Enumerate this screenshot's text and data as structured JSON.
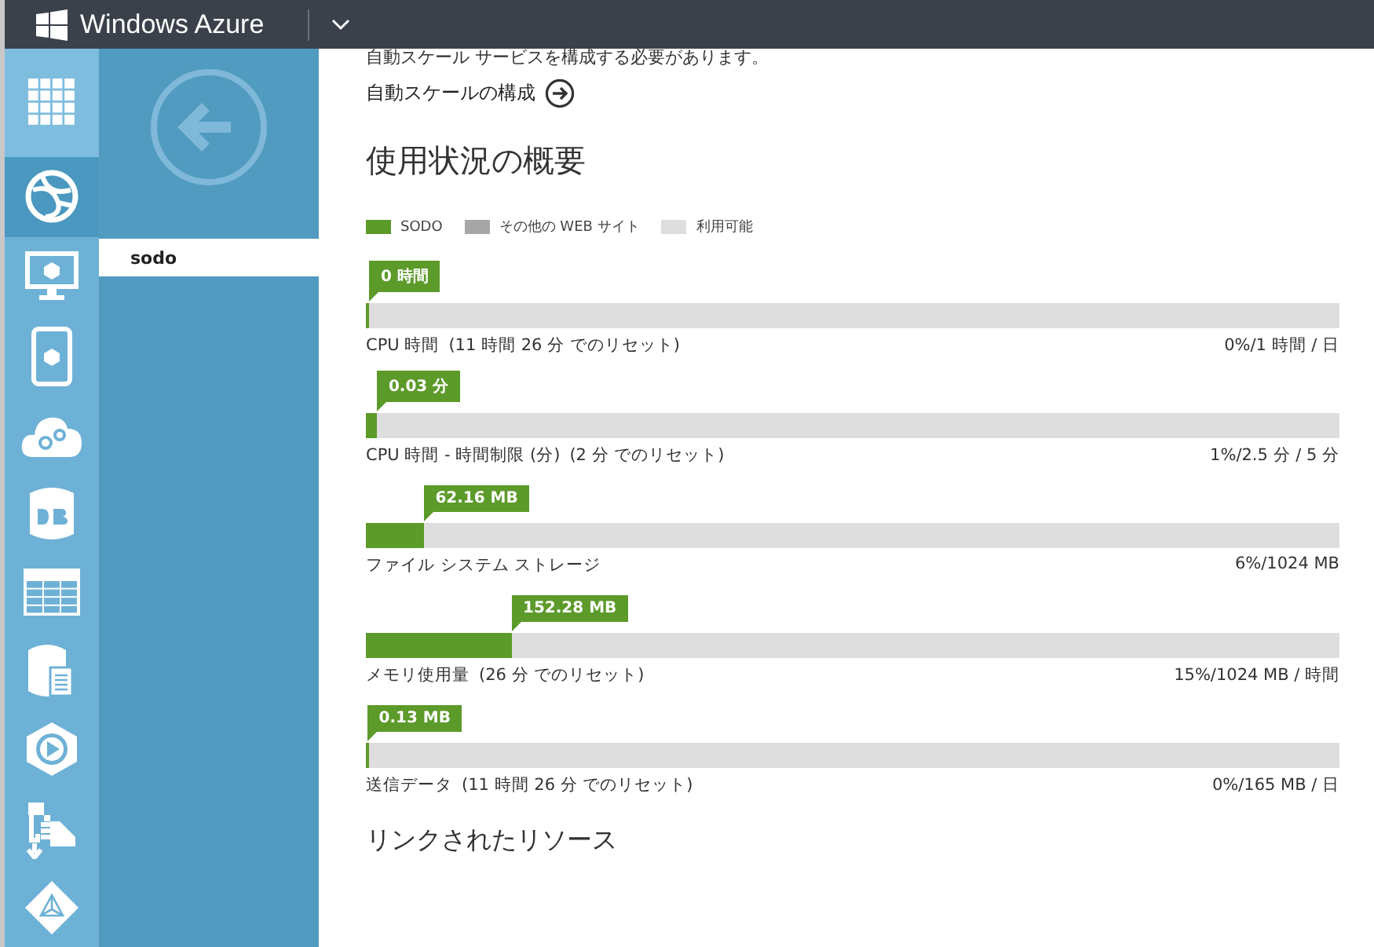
{
  "header": {
    "title": "Windows Azure"
  },
  "rail": [
    {
      "kind": "grid",
      "selected": false
    },
    {
      "kind": "globe",
      "selected": true
    },
    {
      "kind": "monitor",
      "selected": false
    },
    {
      "kind": "phone",
      "selected": false
    },
    {
      "kind": "cloud",
      "selected": false
    },
    {
      "kind": "db",
      "selected": false
    },
    {
      "kind": "table",
      "selected": false
    },
    {
      "kind": "storage",
      "selected": false
    },
    {
      "kind": "media",
      "selected": false
    },
    {
      "kind": "import",
      "selected": false
    },
    {
      "kind": "directory",
      "selected": false
    }
  ],
  "subnav": {
    "items": [
      {
        "label": "sodo",
        "selected": true
      }
    ]
  },
  "content": {
    "notice": "自動スケール サービスを構成する必要があります。",
    "autoscale_link": "自動スケールの構成",
    "heading": "使用状況の概要",
    "legend": [
      {
        "label": "SODO",
        "color": "#5c9a2a"
      },
      {
        "label": "その他の WEB サイト",
        "color": "#a6a6a6"
      },
      {
        "label": "利用可能",
        "color": "#dedede"
      }
    ],
    "meters": [
      {
        "callout": "0 時間",
        "title": "CPU 時間",
        "note": "(11 時間 26 分 でのリセット)",
        "reading": "0%/1 時間 / 日",
        "level": 0.004
      },
      {
        "callout": "0.03 分",
        "title": "CPU 時間 - 時間制限 (分)",
        "note": "(2 分 でのリセット)",
        "reading": "1%/2.5 分 / 5 分",
        "level": 0.012
      },
      {
        "callout": "62.16 MB",
        "title": "ファイル システム ストレージ",
        "reading": "6%/1024 MB",
        "level": 0.06
      },
      {
        "callout": "152.28 MB",
        "title": "メモリ使用量",
        "note": "(26 分 でのリセット)",
        "reading": "15%/1024 MB / 時間",
        "level": 0.15
      },
      {
        "callout": "0.13 MB",
        "title": "送信データ",
        "note": "(11 時間 26 分 でのリセット)",
        "reading": "0%/165 MB / 日",
        "level": 0.002
      }
    ],
    "next_heading": "リンクされたリソース"
  }
}
